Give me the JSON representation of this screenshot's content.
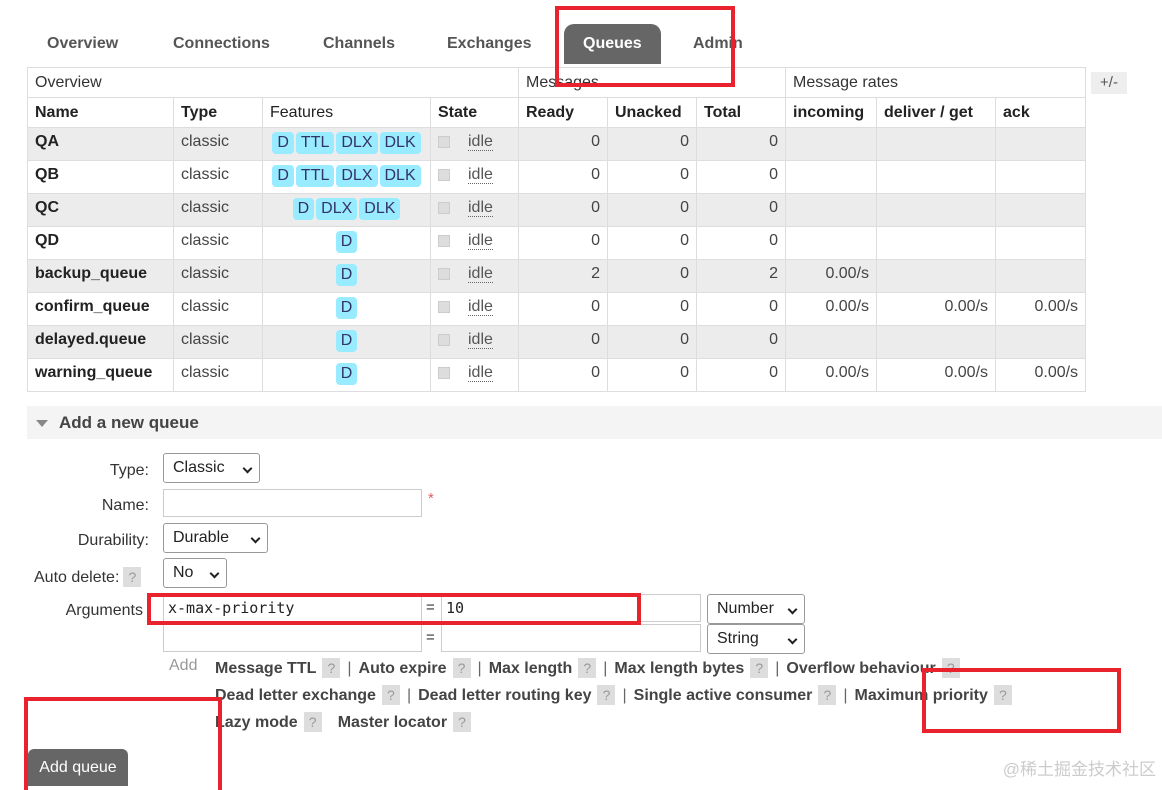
{
  "tabs": [
    "Overview",
    "Connections",
    "Channels",
    "Exchanges",
    "Queues",
    "Admin"
  ],
  "table": {
    "group_headers": [
      "Overview",
      "Messages",
      "Message rates"
    ],
    "toggle_label": "+/-",
    "columns": [
      "Name",
      "Type",
      "Features",
      "State",
      "Ready",
      "Unacked",
      "Total",
      "incoming",
      "deliver / get",
      "ack"
    ],
    "rows": [
      {
        "name": "QA",
        "type": "classic",
        "features": [
          "D",
          "TTL",
          "DLX",
          "DLK"
        ],
        "state": "idle",
        "ready": "0",
        "unacked": "0",
        "total": "0",
        "incoming": "",
        "deliver": "",
        "ack": ""
      },
      {
        "name": "QB",
        "type": "classic",
        "features": [
          "D",
          "TTL",
          "DLX",
          "DLK"
        ],
        "state": "idle",
        "ready": "0",
        "unacked": "0",
        "total": "0",
        "incoming": "",
        "deliver": "",
        "ack": ""
      },
      {
        "name": "QC",
        "type": "classic",
        "features": [
          "D",
          "DLX",
          "DLK"
        ],
        "state": "idle",
        "ready": "0",
        "unacked": "0",
        "total": "0",
        "incoming": "",
        "deliver": "",
        "ack": ""
      },
      {
        "name": "QD",
        "type": "classic",
        "features": [
          "D"
        ],
        "state": "idle",
        "ready": "0",
        "unacked": "0",
        "total": "0",
        "incoming": "",
        "deliver": "",
        "ack": ""
      },
      {
        "name": "backup_queue",
        "type": "classic",
        "features": [
          "D"
        ],
        "state": "idle",
        "ready": "2",
        "unacked": "0",
        "total": "2",
        "incoming": "0.00/s",
        "deliver": "",
        "ack": ""
      },
      {
        "name": "confirm_queue",
        "type": "classic",
        "features": [
          "D"
        ],
        "state": "idle",
        "ready": "0",
        "unacked": "0",
        "total": "0",
        "incoming": "0.00/s",
        "deliver": "0.00/s",
        "ack": "0.00/s"
      },
      {
        "name": "delayed.queue",
        "type": "classic",
        "features": [
          "D"
        ],
        "state": "idle",
        "ready": "0",
        "unacked": "0",
        "total": "0",
        "incoming": "",
        "deliver": "",
        "ack": ""
      },
      {
        "name": "warning_queue",
        "type": "classic",
        "features": [
          "D"
        ],
        "state": "idle",
        "ready": "0",
        "unacked": "0",
        "total": "0",
        "incoming": "0.00/s",
        "deliver": "0.00/s",
        "ack": "0.00/s"
      }
    ]
  },
  "add_queue": {
    "header": "Add a new queue",
    "type_label": "Type:",
    "type_value": "Classic",
    "name_label": "Name:",
    "name_value": "",
    "required_mark": "*",
    "durability_label": "Durability:",
    "durability_value": "Durable",
    "auto_delete_label": "Auto delete:",
    "auto_delete_value": "No",
    "help_glyph": "?",
    "arguments_label": "Arguments",
    "equals": "=",
    "arguments": [
      {
        "key": "x-max-priority",
        "value": "10",
        "type": "Number"
      },
      {
        "key": "",
        "value": "",
        "type": "String"
      }
    ],
    "add_label": "Add",
    "arg_links_line1": [
      "Message TTL",
      "Auto expire",
      "Max length",
      "Max length bytes",
      "Overflow behaviour"
    ],
    "arg_links_line2": [
      "Dead letter exchange",
      "Dead letter routing key",
      "Single active consumer",
      "Maximum priority"
    ],
    "arg_links_line3": [
      "Lazy mode",
      "Master locator"
    ],
    "button_label": "Add queue"
  },
  "watermark": "@稀土掘金技术社区",
  "colors": {
    "annotation_red": "#e8232d",
    "badge_blue": "#99ebff",
    "active_tab": "#666666"
  }
}
